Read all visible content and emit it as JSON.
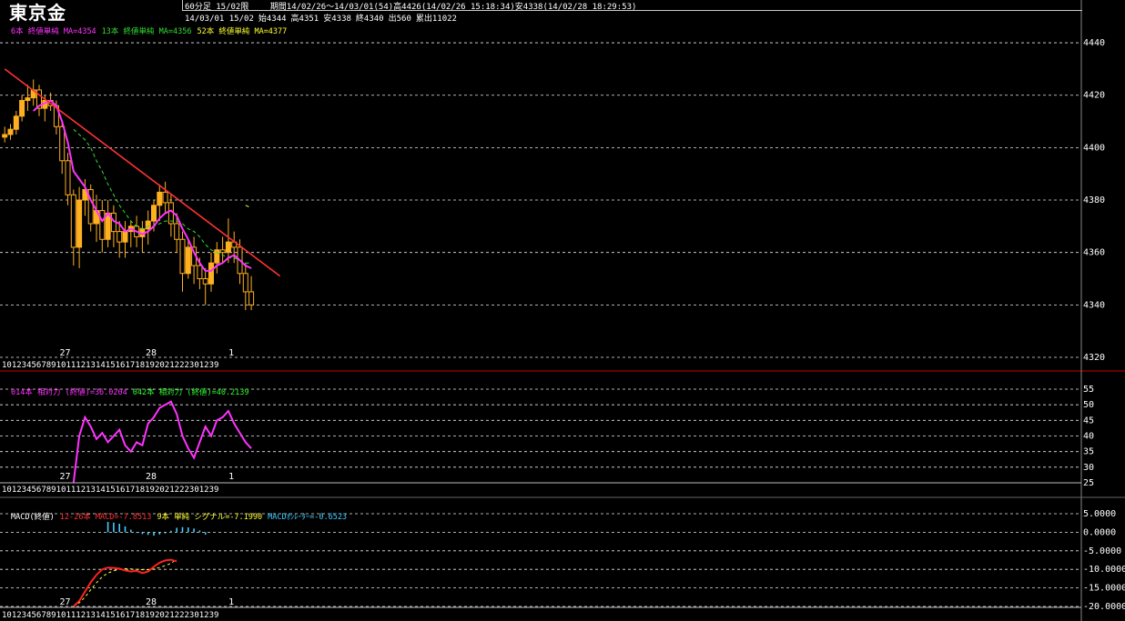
{
  "header": {
    "title": "東京金",
    "timeframe": "60分足 15/02限",
    "period": "期間14/02/26～14/03/01(54)高4426(14/02/26 15:18:34)安4338(14/02/28 18:29:53)",
    "bar_date": "14/03/01 15/02",
    "open": "始4344",
    "high": "高4351",
    "low": "安4338",
    "close": "終4340",
    "volume": "出560",
    "cum_volume": "累出11022"
  },
  "colors": {
    "candle": "#ffb020",
    "ma6": "#ff33ff",
    "ma13": "#33dd33",
    "ma52": "#ffff33",
    "trendline": "#ff3333",
    "rsi14": "#ff33ff",
    "rsi42": "#33ff33",
    "macd": "#ff2222",
    "signal": "#ffff33",
    "osc": "#44ccff",
    "grid": "#e8e8e8",
    "divider": "#cc0000"
  },
  "legends": {
    "price": [
      "6本 終値単純 MA=4354",
      "13本 終値単純 MA=4356",
      "52本 終値単純 MA=4377"
    ],
    "rsi": [
      "014本 相対力 (終値)=36.0204",
      "042本 相対力 (終値)=40.2139"
    ],
    "macd": [
      "MACD(終値)",
      "12-26本 MACD=-7.8513",
      "9本 単純 シグナル=-7.1990",
      "MACDｵｼﾚｰﾀｰ=-0.6523"
    ]
  },
  "chart_data": [
    {
      "type": "candlestick",
      "title": "東京金 60分足 15/02限",
      "date_labels": [
        "27",
        "28",
        "1"
      ],
      "hour_tick_text": "10123456789101112131415161718192021222301239",
      "ylim": [
        4320,
        4448
      ],
      "yticks": [
        4320,
        4340,
        4360,
        4380,
        4400,
        4420,
        4440
      ],
      "grid": true,
      "ohlc": [
        [
          4404,
          4408,
          4402,
          4405
        ],
        [
          4405,
          4409,
          4403,
          4407
        ],
        [
          4407,
          4414,
          4405,
          4412
        ],
        [
          4412,
          4420,
          4410,
          4418
        ],
        [
          4418,
          4424,
          4414,
          4419
        ],
        [
          4419,
          4426,
          4416,
          4422
        ],
        [
          4422,
          4424,
          4412,
          4415
        ],
        [
          4415,
          4420,
          4410,
          4418
        ],
        [
          4418,
          4421,
          4414,
          4416
        ],
        [
          4416,
          4418,
          4405,
          4408
        ],
        [
          4408,
          4410,
          4390,
          4395
        ],
        [
          4395,
          4398,
          4378,
          4382
        ],
        [
          4382,
          4384,
          4355,
          4362
        ],
        [
          4362,
          4385,
          4354,
          4380
        ],
        [
          4380,
          4388,
          4374,
          4384
        ],
        [
          4384,
          4386,
          4368,
          4371
        ],
        [
          4371,
          4382,
          4364,
          4376
        ],
        [
          4376,
          4380,
          4360,
          4365
        ],
        [
          4365,
          4380,
          4362,
          4375
        ],
        [
          4375,
          4378,
          4362,
          4368
        ],
        [
          4368,
          4372,
          4358,
          4364
        ],
        [
          4364,
          4372,
          4358,
          4368
        ],
        [
          4368,
          4372,
          4362,
          4370
        ],
        [
          4370,
          4374,
          4362,
          4366
        ],
        [
          4366,
          4372,
          4360,
          4369
        ],
        [
          4369,
          4376,
          4363,
          4372
        ],
        [
          4372,
          4380,
          4368,
          4378
        ],
        [
          4378,
          4386,
          4372,
          4383
        ],
        [
          4383,
          4387,
          4375,
          4379
        ],
        [
          4379,
          4382,
          4366,
          4371
        ],
        [
          4371,
          4375,
          4360,
          4365
        ],
        [
          4365,
          4368,
          4345,
          4352
        ],
        [
          4352,
          4365,
          4350,
          4362
        ],
        [
          4362,
          4366,
          4348,
          4355
        ],
        [
          4355,
          4358,
          4346,
          4350
        ],
        [
          4350,
          4354,
          4340,
          4348
        ],
        [
          4348,
          4360,
          4345,
          4356
        ],
        [
          4356,
          4364,
          4352,
          4361
        ],
        [
          4361,
          4366,
          4356,
          4360
        ],
        [
          4360,
          4373,
          4356,
          4364
        ],
        [
          4364,
          4368,
          4356,
          4362
        ],
        [
          4362,
          4365,
          4348,
          4352
        ],
        [
          4352,
          4356,
          4338,
          4345
        ],
        [
          4345,
          4351,
          4338,
          4340
        ]
      ],
      "series": [
        {
          "name": "6本 終値単純 MA",
          "values": [
            null,
            null,
            null,
            null,
            null,
            4414,
            4416,
            4417,
            4418,
            4416,
            4410,
            4402,
            4391,
            4388,
            4385,
            4380,
            4376,
            4372,
            4375,
            4372,
            4371,
            4368,
            4369,
            4368,
            4367,
            4368,
            4370,
            4373,
            4375,
            4376,
            4374,
            4369,
            4365,
            4360,
            4356,
            4353,
            4353,
            4355,
            4356,
            4358,
            4359,
            4357,
            4355,
            4354
          ]
        },
        {
          "name": "13本 終値単純 MA",
          "values": [
            null,
            null,
            null,
            null,
            null,
            null,
            null,
            null,
            null,
            null,
            null,
            null,
            4407,
            4405,
            4403,
            4400,
            4395,
            4391,
            4386,
            4382,
            4378,
            4375,
            4372,
            4370,
            4369,
            4370,
            4370,
            4371,
            4372,
            4372,
            4372,
            4371,
            4369,
            4368,
            4366,
            4363,
            4361,
            4360,
            4359,
            4358,
            4358,
            4357,
            4356,
            4356
          ]
        },
        {
          "name": "52本 終値単純 MA",
          "values": [
            null,
            null,
            null,
            null,
            null,
            null,
            null,
            null,
            null,
            null,
            null,
            null,
            null,
            null,
            null,
            null,
            null,
            null,
            null,
            null,
            null,
            null,
            null,
            null,
            null,
            null,
            null,
            null,
            null,
            null,
            null,
            null,
            null,
            null,
            null,
            null,
            null,
            null,
            null,
            null,
            null,
            null,
            4378,
            4377
          ]
        }
      ],
      "trendline": {
        "from": [
          0,
          4430
        ],
        "to": [
          48,
          4351
        ]
      }
    },
    {
      "type": "line",
      "title": "相対力",
      "ylim": [
        25,
        55
      ],
      "yticks": [
        25,
        30,
        35,
        40,
        45,
        50,
        55
      ],
      "series": [
        {
          "name": "014本 相対力 (終値)",
          "values": [
            null,
            null,
            null,
            null,
            null,
            null,
            null,
            null,
            null,
            null,
            null,
            null,
            25,
            40,
            46,
            43,
            39,
            41,
            38,
            40,
            42,
            37,
            35,
            38,
            37,
            44,
            46,
            49,
            50,
            51,
            47,
            40,
            36,
            33,
            38,
            43,
            40,
            45,
            46,
            48,
            44,
            41,
            38,
            36
          ]
        }
      ]
    },
    {
      "type": "bar-line",
      "title": "MACD(終値)",
      "ylim": [
        -20,
        5
      ],
      "yticks": [
        5,
        0,
        -5,
        -10,
        -15,
        -20
      ],
      "series": [
        {
          "name": "12-26本 MACD",
          "values": [
            null,
            null,
            null,
            null,
            null,
            null,
            null,
            null,
            null,
            null,
            null,
            null,
            -20,
            -18.5,
            -16,
            -13.5,
            -11.5,
            -10,
            -9.5,
            -9.6,
            -9.8,
            -10.3,
            -10.6,
            -10.4,
            -11,
            -10.6,
            -9.3,
            -8.2,
            -7.6,
            -7.4,
            -7.85
          ]
        },
        {
          "name": "9本 単純 シグナル",
          "values": [
            null,
            null,
            null,
            null,
            null,
            null,
            null,
            null,
            null,
            null,
            null,
            null,
            -20,
            -19,
            -17.5,
            -15.5,
            -13.6,
            -12,
            -11,
            -10.4,
            -10,
            -9.8,
            -9.9,
            -10,
            -10.1,
            -10.1,
            -9.9,
            -9.5,
            -9,
            -8.4,
            -7.2
          ]
        },
        {
          "name": "MACDｵｼﾚｰﾀｰ",
          "values": [
            null,
            null,
            null,
            null,
            null,
            null,
            null,
            null,
            null,
            null,
            null,
            null,
            null,
            null,
            null,
            null,
            null,
            null,
            2.8,
            2.6,
            2.3,
            1.6,
            0.7,
            0,
            -0.5,
            -0.7,
            -0.9,
            -0.6,
            -0.3,
            0.4,
            1.2,
            1.4,
            1.3,
            1.0,
            0.5,
            -0.65
          ]
        }
      ]
    }
  ]
}
